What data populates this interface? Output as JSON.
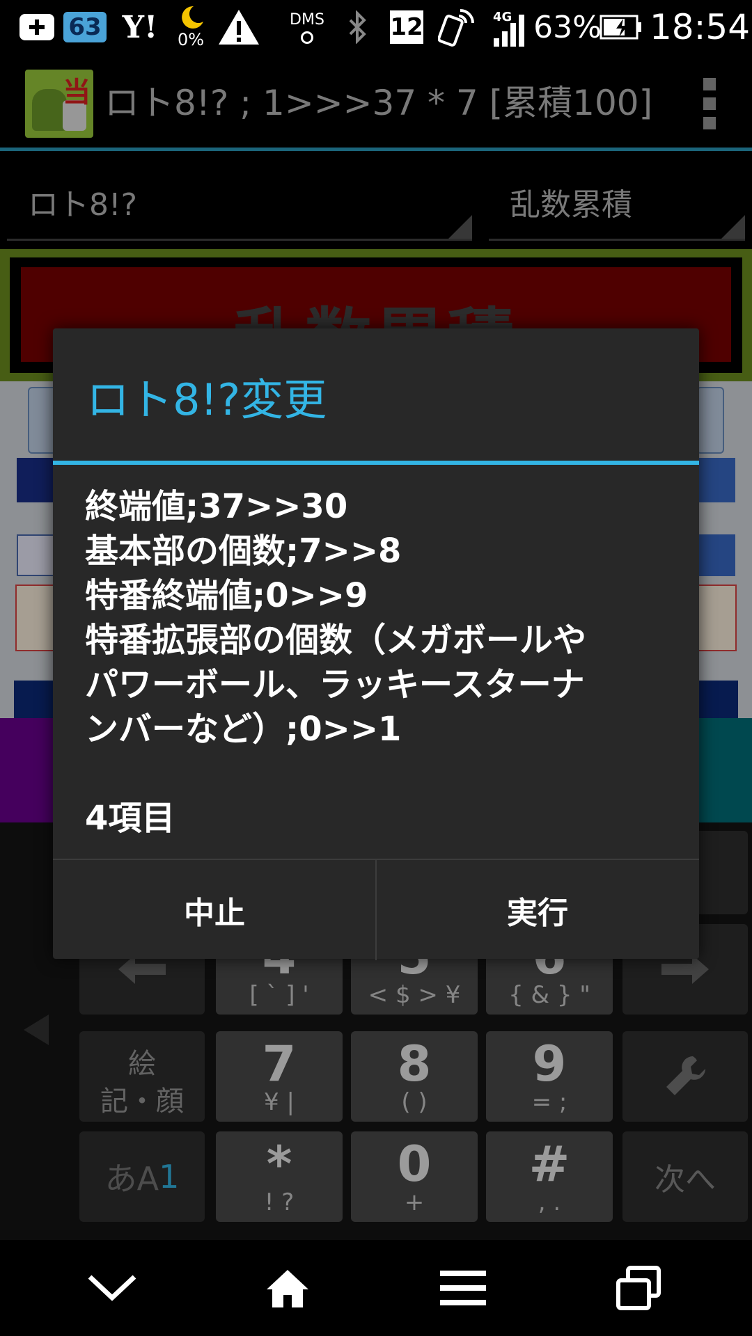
{
  "status_bar": {
    "battery_small": "63",
    "yahoo": "Y!",
    "moon_percent": "0%",
    "dms": "DMS",
    "calendar_day": "12",
    "network": "4G",
    "battery_percent": "63%",
    "time": "18:54"
  },
  "action_bar": {
    "app_icon_kanji": "当",
    "title": "ロト8!? ; 1>>>37 * 7 [累積100]"
  },
  "spinners": {
    "left": "ロト8!?",
    "right": "乱数累積"
  },
  "background": {
    "banner": "乱数累積"
  },
  "dialog": {
    "title": "ロト8!?変更",
    "lines": [
      "終端値;37>>30",
      "基本部の個数;7>>8",
      "特番終端値;0>>9",
      "特番拡張部の個数（メガボールや",
      "パワーボール、ラッキースターナ",
      "ンバーなど）;0>>1"
    ],
    "count": "4項目",
    "cancel": "中止",
    "execute": "実行"
  },
  "keyboard": {
    "row1": [
      {
        "main": "4",
        "sub": "[ ` ] '"
      },
      {
        "main": "5",
        "sub": "< $ > ¥"
      },
      {
        "main": "6",
        "sub": "{ & } \""
      }
    ],
    "row2": [
      {
        "main": "7",
        "sub": "¥ |"
      },
      {
        "main": "8",
        "sub": "( )"
      },
      {
        "main": "9",
        "sub": "= ;"
      }
    ],
    "row3": [
      {
        "main": "*",
        "sub": "! ?"
      },
      {
        "main": "0",
        "sub": "+"
      },
      {
        "main": "#",
        "sub": ", ."
      }
    ],
    "emoji_key_line1": "絵",
    "emoji_key_line2": "記・顔",
    "mode_key": "あA",
    "mode_key_digit": "1",
    "next_key": "次へ"
  },
  "colors": {
    "accent": "#33b5e5",
    "dialog_bg": "#282828",
    "banner_red": "#7a0000"
  }
}
